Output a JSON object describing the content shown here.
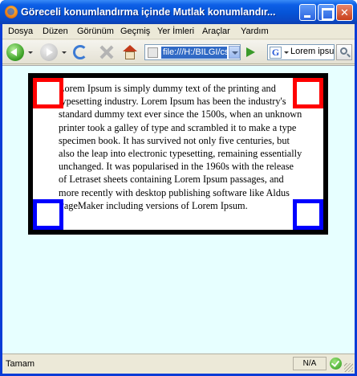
{
  "window": {
    "title": "Göreceli konumlandırma içinde Mutlak konumlandır..."
  },
  "menu": {
    "items": [
      "Dosya",
      "Düzen",
      "Görünüm",
      "Geçmiş",
      "Yer İmleri",
      "Araçlar",
      "Yardım"
    ]
  },
  "toolbar": {
    "url": "file:///H:/BILGI/cs",
    "search_value": "Lorem ipsu",
    "search_engine_label": "G"
  },
  "content": {
    "lorem_text": "Lorem Ipsum is simply dummy text of the printing and typesetting industry.  Lorem Ipsum has been the industry's standard dummy text ever since the 1500s, when an unknown printer took a galley of type and scrambled it to make a type specimen book. It has survived not only five centuries, but also the leap into electronic typesetting, remaining essentially unchanged. It was popularised in the 1960s with the release of Letraset sheets containing Lorem Ipsum passages, and more recently with desktop publishing software like Aldus PageMaker including versions of Lorem Ipsum.",
    "corner_colors": {
      "top": "#ff0000",
      "bottom": "#0000ff"
    },
    "page_background": "#e7ffff"
  },
  "status": {
    "text": "Tamam",
    "panel": "N/A"
  }
}
